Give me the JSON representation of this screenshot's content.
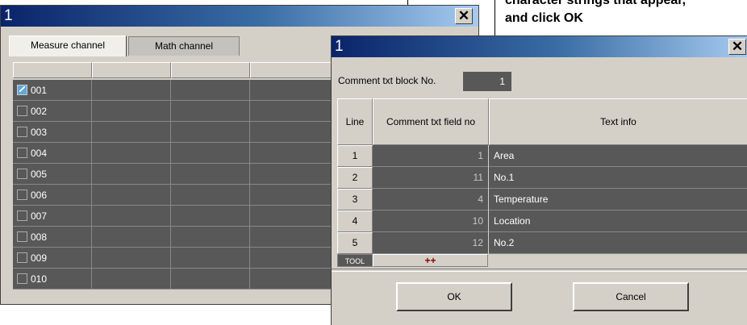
{
  "annotation": {
    "line1": "character strings that appear,",
    "line2": "and click OK"
  },
  "channel_window": {
    "title": "1",
    "close_glyph": "✕",
    "tabs": [
      {
        "label": "Measure channel"
      },
      {
        "label": "Math channel"
      }
    ],
    "rows": [
      {
        "channel": "001",
        "checked": true
      },
      {
        "channel": "002",
        "checked": false
      },
      {
        "channel": "003",
        "checked": false
      },
      {
        "channel": "004",
        "checked": false
      },
      {
        "channel": "005",
        "checked": false
      },
      {
        "channel": "006",
        "checked": false
      },
      {
        "channel": "007",
        "checked": false
      },
      {
        "channel": "008",
        "checked": false
      },
      {
        "channel": "009",
        "checked": false
      },
      {
        "channel": "010",
        "checked": false
      }
    ]
  },
  "comment_dialog": {
    "title": "1",
    "close_glyph": "✕",
    "block_label": "Comment txt block No.",
    "block_value": "1",
    "columns": {
      "line": "Line",
      "field_no": "Comment txt field no",
      "text_info": "Text info"
    },
    "rows": [
      {
        "line": "1",
        "field_no": "1",
        "text": "Area"
      },
      {
        "line": "2",
        "field_no": "11",
        "text": "No.1"
      },
      {
        "line": "3",
        "field_no": "4",
        "text": "Temperature"
      },
      {
        "line": "4",
        "field_no": "10",
        "text": "Location"
      },
      {
        "line": "5",
        "field_no": "12",
        "text": "No.2"
      }
    ],
    "tool_label": "TOOL",
    "add_label": "++",
    "ok_label": "OK",
    "cancel_label": "Cancel"
  },
  "colors": {
    "title_bar_start": "#0a246a",
    "title_bar_end": "#a6caf0",
    "cell_dark": "#585858",
    "window_face": "#d4d0c8"
  }
}
